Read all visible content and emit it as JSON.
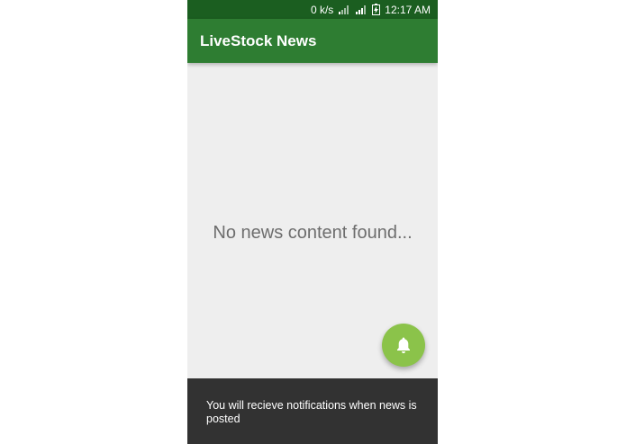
{
  "status_bar": {
    "speed": "0 k/s",
    "time": "12:17 AM",
    "icons": [
      "signal-1-icon",
      "signal-2-icon",
      "battery-charging-icon"
    ]
  },
  "app_bar": {
    "title": "LiveStock News"
  },
  "content": {
    "empty_message": "No news content found..."
  },
  "fab": {
    "icon": "bell-icon"
  },
  "snackbar": {
    "message": "You will recieve notifications when news is posted"
  },
  "colors": {
    "status_bar": "#1b5e20",
    "app_bar": "#2e7d32",
    "fab": "#8bc34a",
    "snackbar": "#323232",
    "background": "#eeeeee"
  }
}
